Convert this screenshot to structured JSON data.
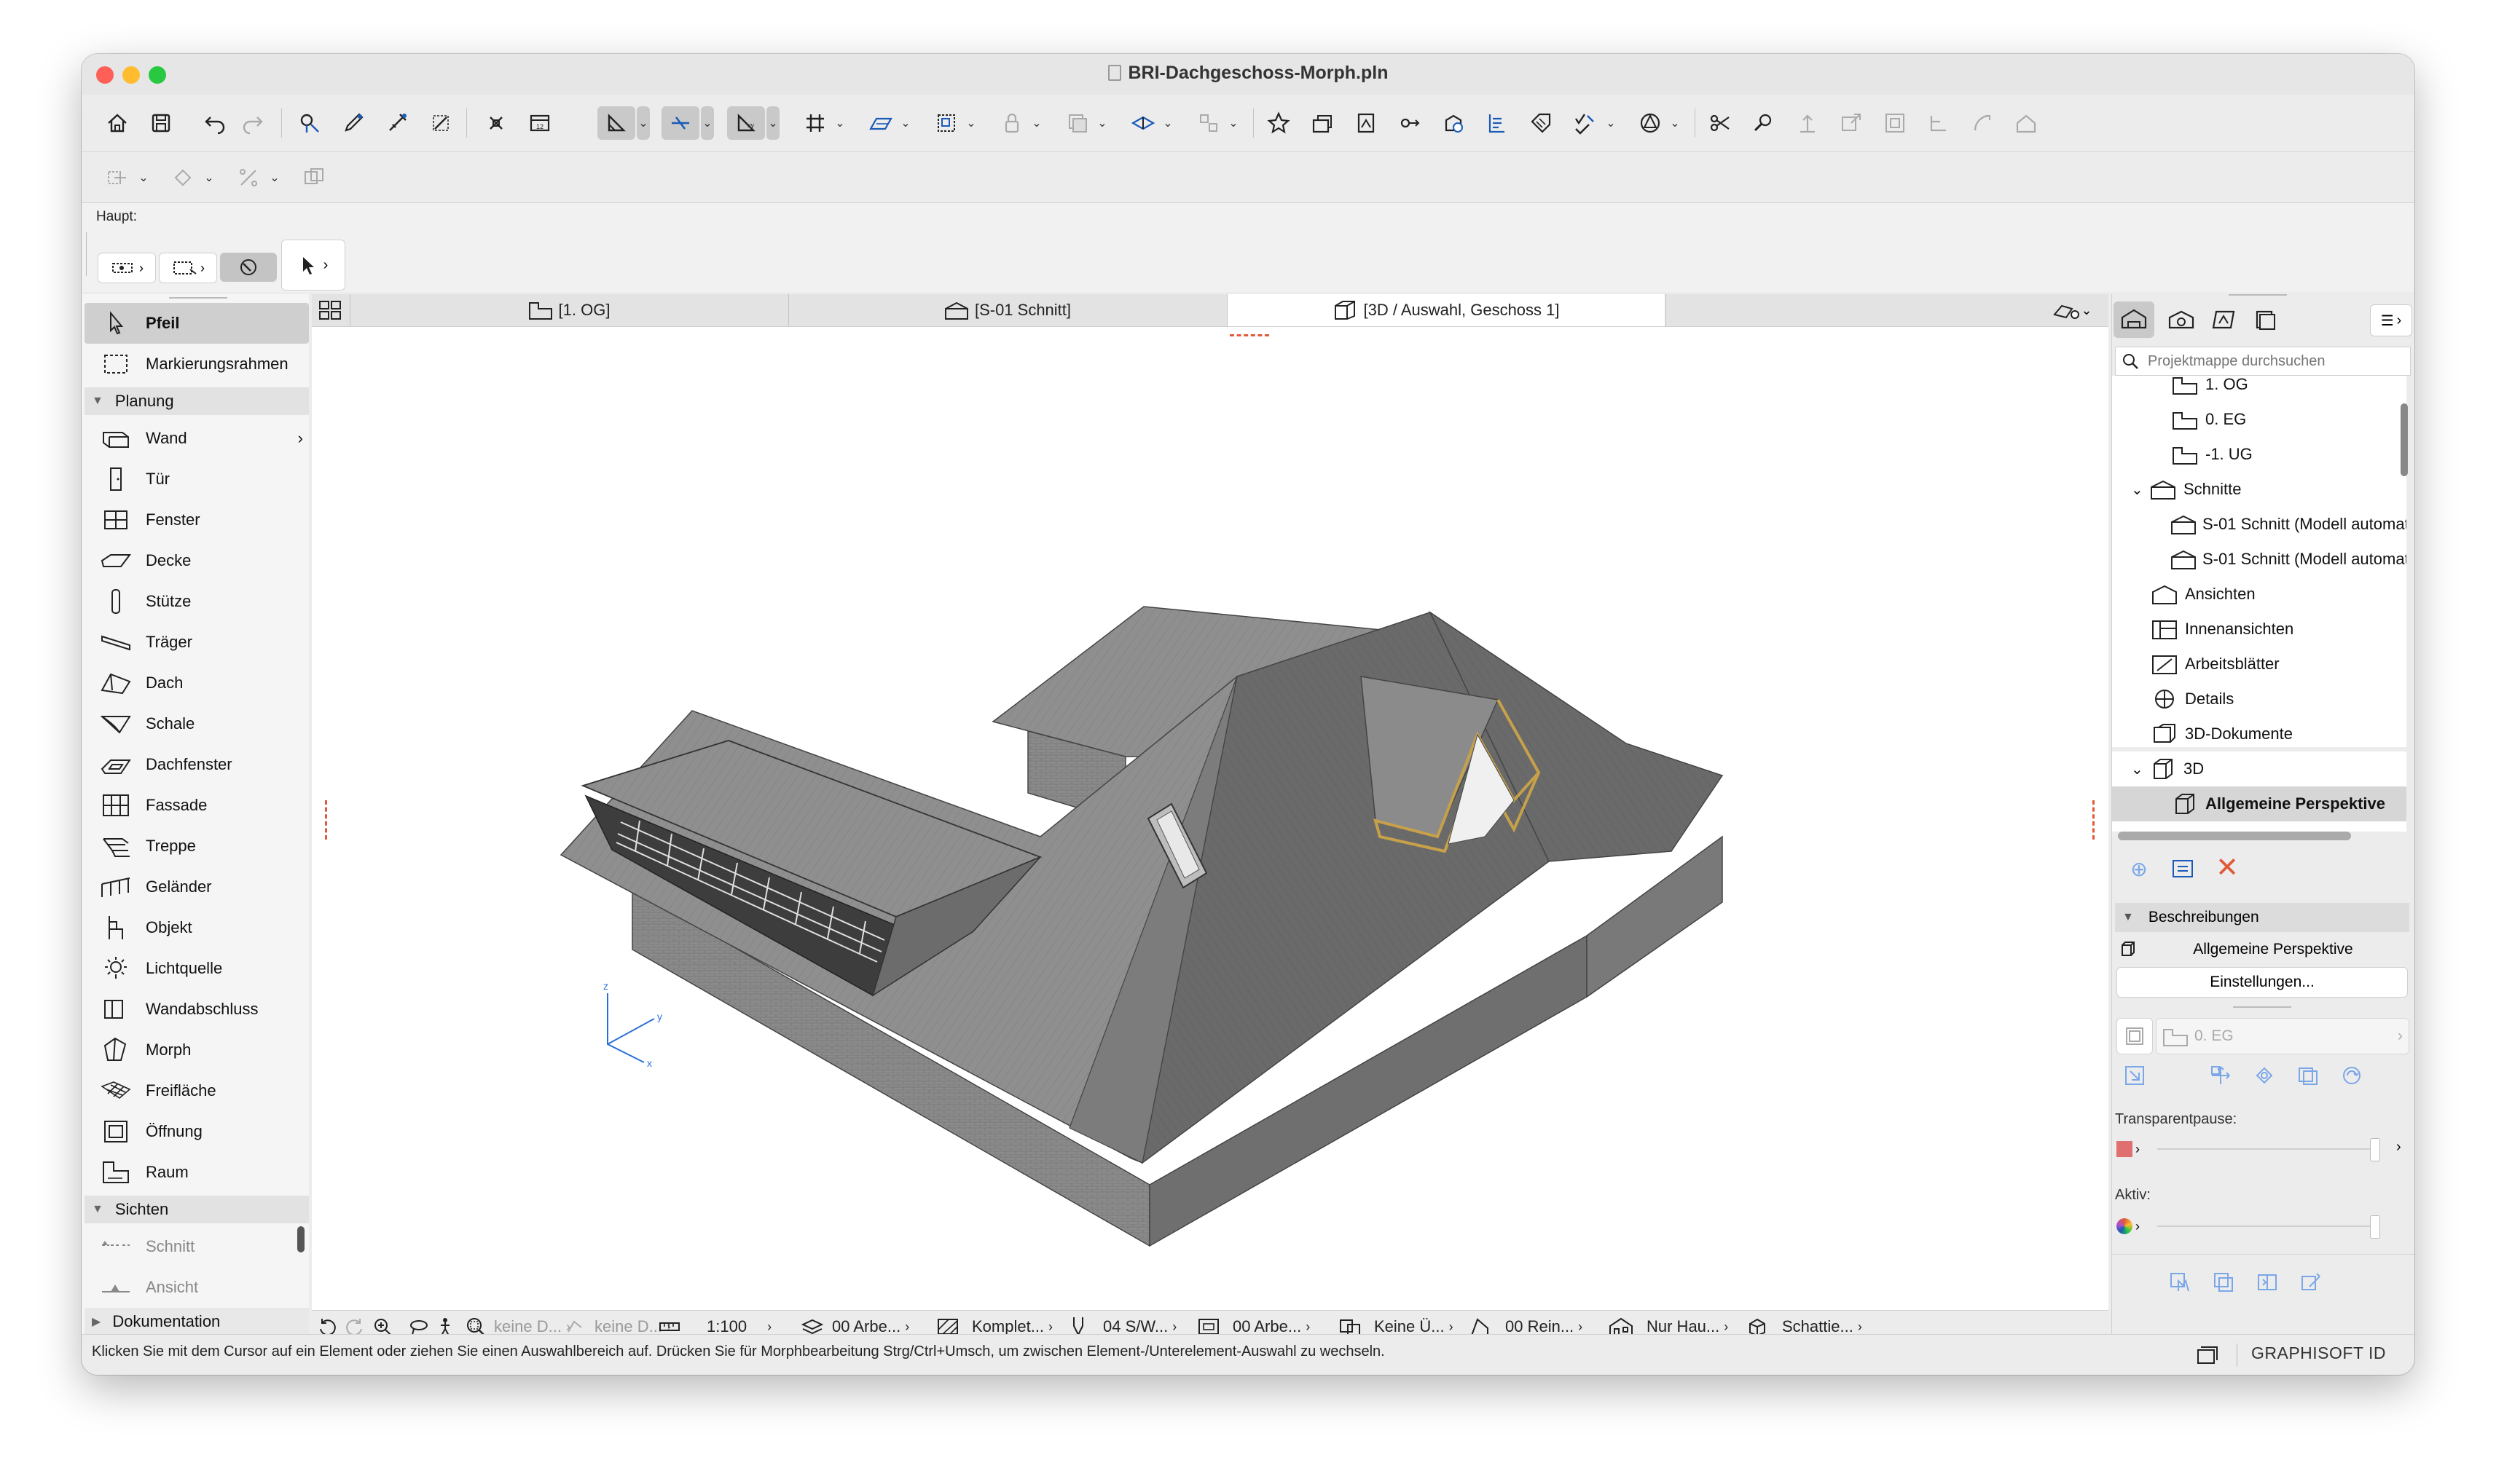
{
  "window": {
    "title": "BRI-Dachgeschoss-Morph.pln"
  },
  "infobox": {
    "label": "Haupt:"
  },
  "toolbox": {
    "arrow": "Pfeil",
    "marquee": "Markierungsrahmen",
    "categories": {
      "planung": "Planung",
      "sichten": "Sichten",
      "dokumentation": "Dokumentation"
    },
    "tools": [
      "Wand",
      "Tür",
      "Fenster",
      "Decke",
      "Stütze",
      "Träger",
      "Dach",
      "Schale",
      "Dachfenster",
      "Fassade",
      "Treppe",
      "Geländer",
      "Objekt",
      "Lichtquelle",
      "Wandabschluss",
      "Morph",
      "Freifläche",
      "Öffnung",
      "Raum"
    ],
    "sichten_tools": [
      "Schnitt",
      "Ansicht"
    ]
  },
  "tabs": [
    {
      "label": "[1. OG]"
    },
    {
      "label": "[S-01 Schnitt]"
    },
    {
      "label": "[3D / Auswahl, Geschoss 1]"
    }
  ],
  "navigator": {
    "search_placeholder": "Projektmappe durchsuchen",
    "items": [
      {
        "label": "1. OG"
      },
      {
        "label": "0. EG"
      },
      {
        "label": "-1. UG"
      },
      {
        "label": "Schnitte"
      },
      {
        "label": "S-01 Schnitt (Modell automatisch w"
      },
      {
        "label": "S-01 Schnitt (Modell automatisch w"
      },
      {
        "label": "Ansichten"
      },
      {
        "label": "Innenansichten"
      },
      {
        "label": "Arbeitsblätter"
      },
      {
        "label": "Details"
      },
      {
        "label": "3D-Dokumente"
      },
      {
        "label": "3D"
      },
      {
        "label": "Allgemeine Perspektive"
      }
    ],
    "descriptions_header": "Beschreibungen",
    "view_name": "Allgemeine Perspektive",
    "settings_button": "Einstellungen...",
    "story_field": "0. EG",
    "transparent_label": "Transparentpause:",
    "active_label": "Aktiv:"
  },
  "quick_options": {
    "d1": "keine D...",
    "d2": "keine D...",
    "scale": "1:100",
    "layer": "00 Arbe...",
    "model": "Komplet...",
    "pen": "04 S/W...",
    "override": "00 Arbe...",
    "renovation": "Keine Ü...",
    "filter": "00 Rein...",
    "structure": "Nur Hau...",
    "shadow": "Schattie..."
  },
  "status": {
    "message": "Klicken Sie mit dem Cursor auf ein Element oder ziehen Sie einen Auswahlbereich auf. Drücken Sie für Morphbearbeitung Strg/Ctrl+Umsch, um zwischen Element-/Unterelement-Auswahl zu wechseln.",
    "brand": "GRAPHISOFT ID"
  },
  "colors": {
    "accent_red": "#e05a3a",
    "traffic_red": "#fe5f57",
    "traffic_yellow": "#febc2e",
    "traffic_green": "#28c840"
  },
  "axes": {
    "x": "x",
    "y": "y",
    "z": "z"
  }
}
